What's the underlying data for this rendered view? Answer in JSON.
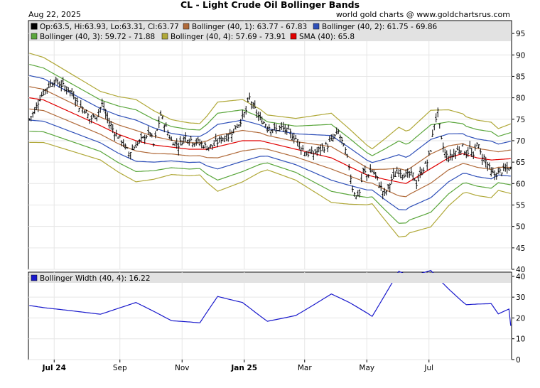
{
  "header": {
    "date": "Aug 22, 2025",
    "title": "CL  -  Light Crude Oil Bollinger Bands",
    "credit": "world gold charts @ www.goldchartsrus.com"
  },
  "colors": {
    "price": "#000000",
    "sma": "#e00000",
    "b1": "#b06a3a",
    "b2": "#2e4fb8",
    "b3": "#5aa63c",
    "b4": "#b0a838",
    "width": "#1a1acc",
    "legend_bg": "#e2e2e2",
    "grid": "#e6e6e6"
  },
  "legend": {
    "price": "Op:63.5, Hi:63.93, Lo:63.31, Cl:63.77",
    "b1": "Bollinger (40, 1): 63.77 - 67.83",
    "b2": "Bollinger (40, 2): 61.75 - 69.86",
    "b3": "Bollinger (40, 3): 59.72 - 71.88",
    "b4": "Bollinger (40, 4): 57.69 - 73.91",
    "sma": "SMA (40): 65.8",
    "width": "Bollinger Width (40, 4): 16.22"
  },
  "chart_data": [
    {
      "type": "line",
      "title": "CL  -  Light Crude Oil Bollinger Bands",
      "ylim": [
        40,
        98
      ],
      "y_ticks": [
        40,
        45,
        50,
        55,
        60,
        65,
        70,
        75,
        80,
        85,
        90,
        95
      ],
      "x_labels": [
        "Jul 24",
        "Sep",
        "Nov",
        "Jan 25",
        "Mar",
        "May",
        "Jul"
      ],
      "grid": true,
      "legend_position": "top-left",
      "sma": [
        [
          0,
          80
        ],
        [
          8,
          79.5
        ],
        [
          16,
          78
        ],
        [
          24,
          76.5
        ],
        [
          32,
          75
        ],
        [
          40,
          73.5
        ],
        [
          50,
          71.5
        ],
        [
          60,
          70
        ],
        [
          70,
          69
        ],
        [
          80,
          68.5
        ],
        [
          90,
          68
        ],
        [
          100,
          68
        ],
        [
          110,
          69
        ],
        [
          120,
          70
        ],
        [
          130,
          70
        ],
        [
          140,
          69
        ],
        [
          150,
          68
        ],
        [
          160,
          67
        ],
        [
          170,
          66
        ],
        [
          180,
          64
        ],
        [
          190,
          62
        ],
        [
          200,
          61
        ],
        [
          212,
          60
        ],
        [
          220,
          62
        ],
        [
          228,
          64
        ],
        [
          236,
          66
        ],
        [
          244,
          67
        ],
        [
          252,
          66
        ],
        [
          260,
          65.5
        ],
        [
          271,
          65.8
        ]
      ],
      "half_width": [
        [
          0,
          2.6
        ],
        [
          20,
          2.3
        ],
        [
          40,
          2.0
        ],
        [
          60,
          2.4
        ],
        [
          80,
          1.6
        ],
        [
          96,
          1.5
        ],
        [
          106,
          2.6
        ],
        [
          120,
          2.4
        ],
        [
          134,
          1.6
        ],
        [
          150,
          1.8
        ],
        [
          160,
          2.2
        ],
        [
          170,
          2.6
        ],
        [
          180,
          2.2
        ],
        [
          193,
          1.6
        ],
        [
          208,
          3.2
        ],
        [
          214,
          3.0
        ],
        [
          226,
          3.4
        ],
        [
          236,
          2.8
        ],
        [
          246,
          2.2
        ],
        [
          255,
          2.2
        ],
        [
          260,
          2.2
        ],
        [
          264,
          1.8
        ],
        [
          271,
          2.03
        ]
      ],
      "close_path": [
        [
          0,
          75
        ],
        [
          3,
          77
        ],
        [
          6,
          80
        ],
        [
          10,
          82.5
        ],
        [
          14,
          84
        ],
        [
          18,
          83
        ],
        [
          22,
          82
        ],
        [
          26,
          80
        ],
        [
          28,
          78
        ],
        [
          31,
          77.5
        ],
        [
          34,
          75
        ],
        [
          38,
          76
        ],
        [
          41,
          78.5
        ],
        [
          44,
          75
        ],
        [
          48,
          72
        ],
        [
          52,
          70
        ],
        [
          56,
          67
        ],
        [
          60,
          69
        ],
        [
          64,
          70.5
        ],
        [
          68,
          72
        ],
        [
          70,
          69
        ],
        [
          74,
          76
        ],
        [
          76,
          74
        ],
        [
          80,
          70
        ],
        [
          84,
          69
        ],
        [
          88,
          71
        ],
        [
          92,
          70
        ],
        [
          96,
          69.5
        ],
        [
          100,
          68.5
        ],
        [
          104,
          69
        ],
        [
          108,
          70.5
        ],
        [
          112,
          71
        ],
        [
          114,
          72
        ],
        [
          118,
          74
        ],
        [
          122,
          77
        ],
        [
          124,
          80
        ],
        [
          126,
          78
        ],
        [
          130,
          75
        ],
        [
          134,
          73.5
        ],
        [
          138,
          72.5
        ],
        [
          142,
          73
        ],
        [
          146,
          72
        ],
        [
          150,
          70.5
        ],
        [
          154,
          68
        ],
        [
          156,
          67
        ],
        [
          160,
          67
        ],
        [
          164,
          68
        ],
        [
          168,
          69
        ],
        [
          172,
          71
        ],
        [
          174,
          72
        ],
        [
          178,
          67.5
        ],
        [
          180,
          64
        ],
        [
          182,
          59
        ],
        [
          184,
          57
        ],
        [
          186,
          58
        ],
        [
          188,
          63
        ],
        [
          190,
          62
        ],
        [
          193,
          63
        ],
        [
          196,
          61
        ],
        [
          198,
          59
        ],
        [
          200,
          57.5
        ],
        [
          202,
          59
        ],
        [
          204,
          61
        ],
        [
          208,
          63
        ],
        [
          212,
          62
        ],
        [
          216,
          62
        ],
        [
          218,
          60
        ],
        [
          220,
          62
        ],
        [
          222,
          63.5
        ],
        [
          224,
          65
        ],
        [
          226,
          68
        ],
        [
          228,
          74
        ],
        [
          230,
          76.5
        ],
        [
          232,
          70
        ],
        [
          234,
          67
        ],
        [
          236,
          66
        ],
        [
          238,
          66.5
        ],
        [
          240,
          67.5
        ],
        [
          242,
          68
        ],
        [
          244,
          68.5
        ],
        [
          246,
          67
        ],
        [
          248,
          68
        ],
        [
          250,
          66
        ],
        [
          252,
          70
        ],
        [
          254,
          67
        ],
        [
          256,
          66
        ],
        [
          258,
          64.5
        ],
        [
          260,
          62.5
        ],
        [
          262,
          62
        ],
        [
          264,
          62.5
        ],
        [
          266,
          63
        ],
        [
          268,
          63.2
        ],
        [
          271,
          63.77
        ]
      ],
      "last_bar": {
        "open": 63.5,
        "high": 63.93,
        "low": 63.31,
        "close": 63.77
      },
      "series": [
        {
          "name": "SMA (40)",
          "last": 65.8
        },
        {
          "name": "Bollinger (40, 1)",
          "lower": 63.77,
          "upper": 67.83
        },
        {
          "name": "Bollinger (40, 2)",
          "lower": 61.75,
          "upper": 69.86
        },
        {
          "name": "Bollinger (40, 3)",
          "lower": 59.72,
          "upper": 71.88
        },
        {
          "name": "Bollinger (40, 4)",
          "lower": 57.69,
          "upper": 73.91
        }
      ]
    },
    {
      "type": "line",
      "title": "Bollinger Width (40, 4): 16.22",
      "ylim": [
        0,
        42
      ],
      "y_ticks": [
        0,
        10,
        20,
        30,
        40
      ],
      "x_labels": [
        "Jul 24",
        "Sep",
        "Nov",
        "Jan 25",
        "Mar",
        "May",
        "Jul"
      ],
      "last": 16.22
    }
  ]
}
